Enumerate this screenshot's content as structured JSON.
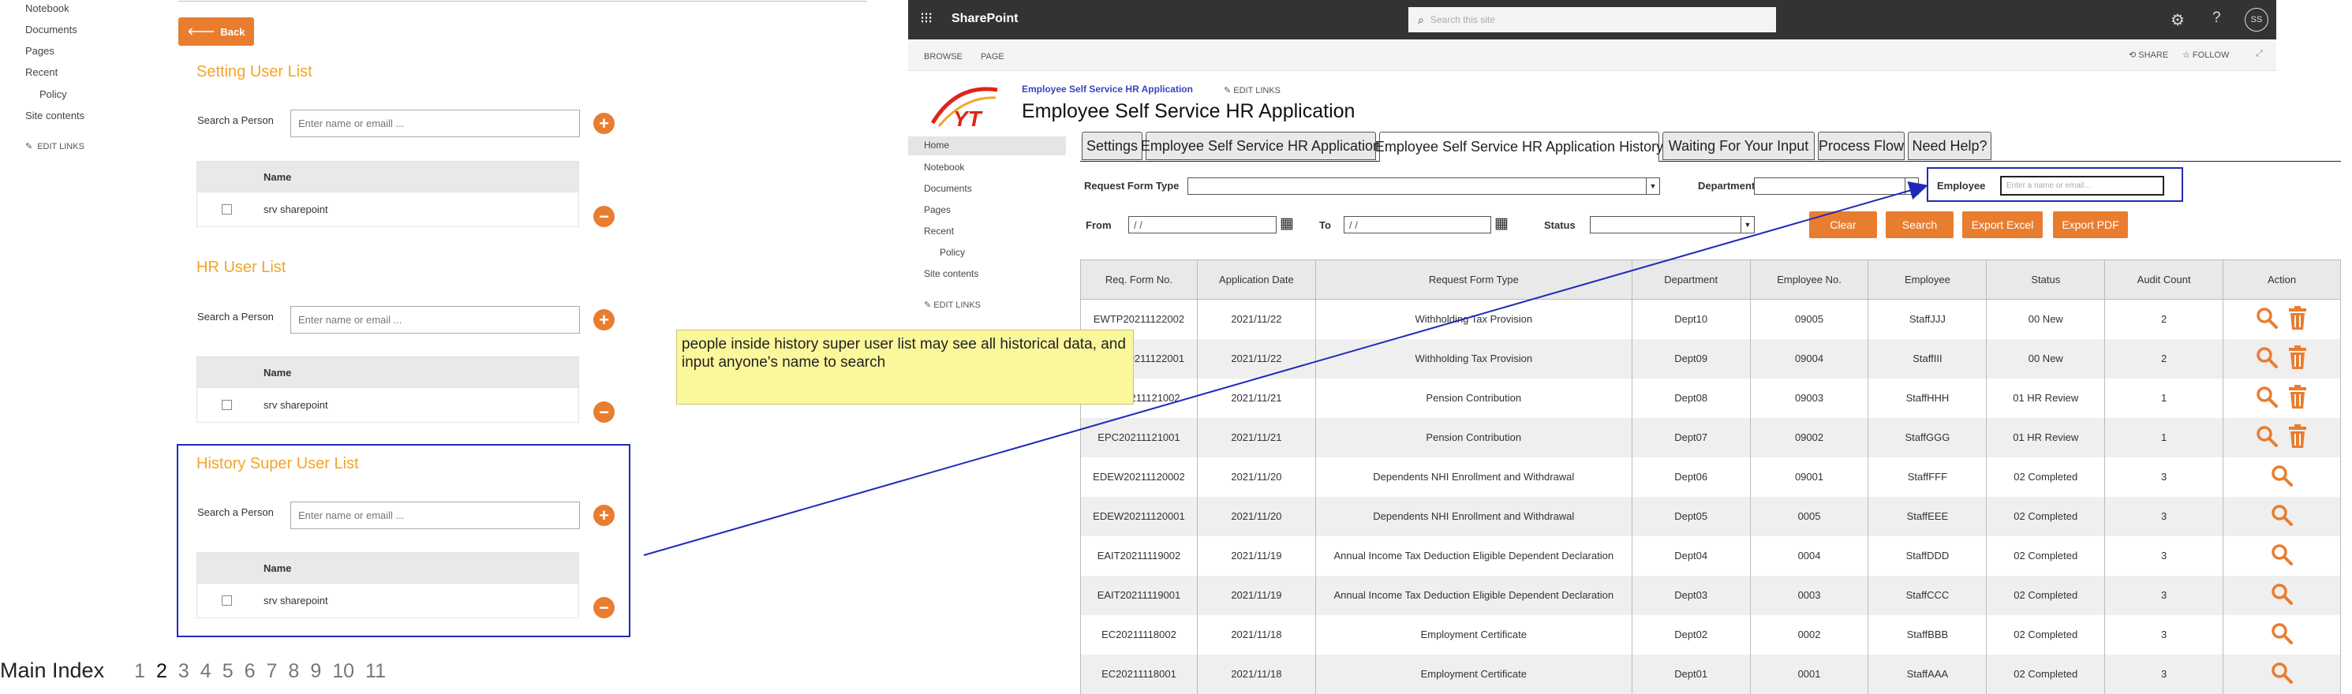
{
  "left_nav": {
    "items": [
      "Notebook",
      "Documents",
      "Pages",
      "Recent",
      "Policy",
      "Site contents"
    ],
    "edit_links": "EDIT LINKS"
  },
  "settings_panel": {
    "back_label": "Back",
    "sections": [
      {
        "title": "Setting User List",
        "search_label": "Search a Person",
        "placeholder": "Enter name or emaill ...",
        "column": "Name",
        "row": "srv sharepoint"
      },
      {
        "title": "HR User List",
        "search_label": "Search a Person",
        "placeholder": "Enter name or email ...",
        "column": "Name",
        "row": "srv sharepoint"
      },
      {
        "title": "History Super User List",
        "search_label": "Search a Person",
        "placeholder": "Enter name or emaill ...",
        "column": "Name",
        "row": "srv sharepoint"
      }
    ]
  },
  "pager": {
    "label": "Main Index",
    "pages": [
      "1",
      "2",
      "3",
      "4",
      "5",
      "6",
      "7",
      "8",
      "9",
      "10",
      "11"
    ],
    "current": "2"
  },
  "annotation": {
    "text": "people inside history super user list may see all historical data, and input anyone's name to search"
  },
  "sp": {
    "brand": "SharePoint",
    "search_placeholder": "Search this site",
    "avatar": "SS",
    "ribbon": {
      "browse": "BROWSE",
      "page": "PAGE",
      "share": "SHARE",
      "follow": "FOLLOW"
    },
    "breadcrumb": "Employee Self Service HR Application",
    "edit_links": "EDIT LINKS",
    "title": "Employee Self Service HR Application",
    "logo_text": "YT",
    "quick_launch": [
      "Home",
      "Notebook",
      "Documents",
      "Pages",
      "Recent",
      "Policy",
      "Site contents"
    ],
    "quick_edit": "EDIT LINKS",
    "tabs": [
      "Settings",
      "Employee Self Service HR Application",
      "Employee Self Service HR Application History",
      "Waiting For Your Input",
      "Process Flow",
      "Need Help?"
    ],
    "active_tab": 2,
    "filters": {
      "request_form_type": "Request Form Type",
      "department": "Department",
      "employee": "Employee",
      "employee_placeholder": "Enter a name or email...",
      "from": "From",
      "to": "To",
      "status": "Status",
      "date_value": "/ /"
    },
    "buttons": {
      "clear": "Clear",
      "search": "Search",
      "export_excel": "Export Excel",
      "export_pdf": "Export PDF"
    },
    "columns": [
      "Req. Form No.",
      "Application Date",
      "Request Form Type",
      "Department",
      "Employee No.",
      "Employee",
      "Status",
      "Audit Count",
      "Action"
    ],
    "rows": [
      [
        "EWTP20211122002",
        "2021/11/22",
        "Withholding Tax Provision",
        "Dept10",
        "09005",
        "StaffJJJ",
        "00 New",
        "2"
      ],
      [
        "EWTP20211122001",
        "2021/11/22",
        "Withholding Tax Provision",
        "Dept09",
        "09004",
        "StaffIII",
        "00 New",
        "2"
      ],
      [
        "EPC20211121002",
        "2021/11/21",
        "Pension Contribution",
        "Dept08",
        "09003",
        "StaffHHH",
        "01 HR Review",
        "1"
      ],
      [
        "EPC20211121001",
        "2021/11/21",
        "Pension Contribution",
        "Dept07",
        "09002",
        "StaffGGG",
        "01 HR Review",
        "1"
      ],
      [
        "EDEW20211120002",
        "2021/11/20",
        "Dependents NHI Enrollment and Withdrawal",
        "Dept06",
        "09001",
        "StaffFFF",
        "02 Completed",
        "3"
      ],
      [
        "EDEW20211120001",
        "2021/11/20",
        "Dependents NHI Enrollment and Withdrawal",
        "Dept05",
        "0005",
        "StaffEEE",
        "02 Completed",
        "3"
      ],
      [
        "EAIT20211119002",
        "2021/11/19",
        "Annual Income Tax Deduction Eligible Dependent Declaration",
        "Dept04",
        "0004",
        "StaffDDD",
        "02 Completed",
        "3"
      ],
      [
        "EAIT20211119001",
        "2021/11/19",
        "Annual Income Tax Deduction Eligible Dependent Declaration",
        "Dept03",
        "0003",
        "StaffCCC",
        "02 Completed",
        "3"
      ],
      [
        "EC20211118002",
        "2021/11/18",
        "Employment Certificate",
        "Dept02",
        "0002",
        "StaffBBB",
        "02 Completed",
        "3"
      ],
      [
        "EC20211118001",
        "2021/11/18",
        "Employment Certificate",
        "Dept01",
        "0001",
        "StaffAAA",
        "02 Completed",
        "3"
      ]
    ],
    "rows_with_delete": 4
  },
  "colors": {
    "accent": "#e97d2f",
    "title_orange": "#f2a528",
    "highlight_blue": "#1f2bb8",
    "note_yellow": "#fbf79b",
    "topbar": "#333333"
  }
}
